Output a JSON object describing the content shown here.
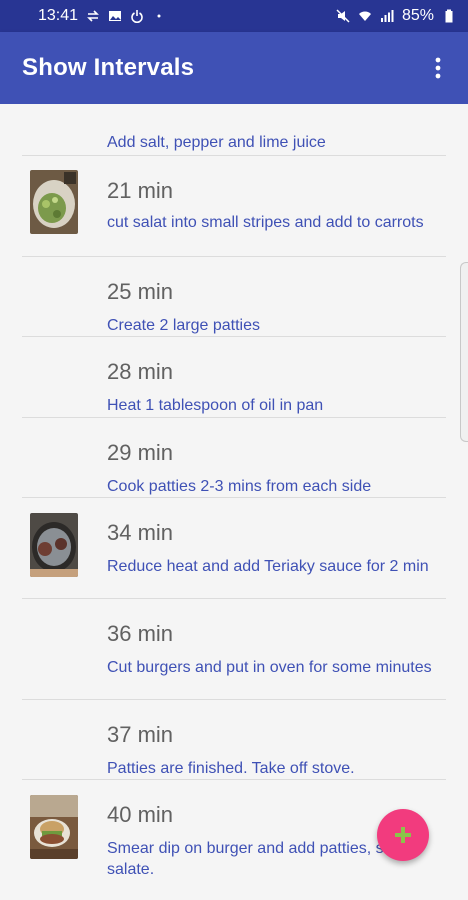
{
  "status_bar": {
    "time": "13:41",
    "battery": "85%",
    "icons": [
      "data-arrows-icon",
      "image-icon",
      "power-icon",
      "dot-icon",
      "mute-icon",
      "wifi-icon",
      "signal-icon",
      "battery-icon"
    ]
  },
  "app_bar": {
    "title": "Show Intervals",
    "overflow_icon": "more-vert-icon"
  },
  "intervals": [
    {
      "time": "",
      "description": "Add salt, pepper and lime juice",
      "has_image": false
    },
    {
      "time": "21 min",
      "description": "cut salat into small stripes and add to carrots",
      "has_image": true
    },
    {
      "time": "25 min",
      "description": "Create 2 large patties",
      "has_image": false
    },
    {
      "time": "28 min",
      "description": "Heat 1 tablespoon of oil in pan",
      "has_image": false
    },
    {
      "time": "29 min",
      "description": "Cook patties 2-3 mins from each side",
      "has_image": false
    },
    {
      "time": "34 min",
      "description": "Reduce heat and add Teriaky sauce for 2 min",
      "has_image": true
    },
    {
      "time": "36 min",
      "description": "Cut burgers and put in oven for some minutes",
      "has_image": false
    },
    {
      "time": "37 min",
      "description": "Patties are finished. Take off stove.",
      "has_image": false
    },
    {
      "time": "40 min",
      "description": "Smear dip on burger and add patties, some salate.",
      "has_image": true
    }
  ],
  "fab": {
    "icon": "plus-icon"
  },
  "colors": {
    "status_bar": "#283593",
    "app_bar": "#3f51b5",
    "accent": "#f23b7e",
    "fab_plus": "#8bc34a",
    "description_text": "#3f51b5",
    "time_text": "#616161"
  }
}
